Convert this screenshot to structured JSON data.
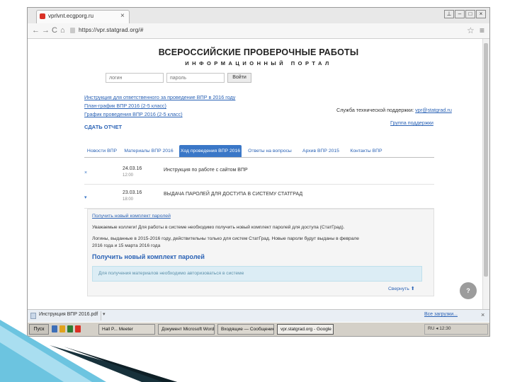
{
  "browser": {
    "tab_title": "vprlvnt.ecgporg.ru",
    "tab_close": "×",
    "address": "https://vpr.statgrad.org/#",
    "window_buttons": [
      "⊥",
      "–",
      "□",
      "×"
    ],
    "nav_glyphs": [
      "←",
      "→",
      "C",
      "⌂"
    ],
    "star_icon": "☆",
    "menu_icon": "≡"
  },
  "page": {
    "title": "ВСЕРОССИЙСКИЕ ПРОВЕРОЧНЫЕ РАБОТЫ",
    "subtitle": "ИНФОРМАЦИОННЫЙ ПОРТАЛ",
    "login_placeholder": "логин",
    "password_placeholder": "пароль",
    "login_button": "Войти",
    "links": [
      "Инструкция для ответственного за проведение ВПР в 2016 году",
      "План-график ВПР 2016 (2-5 класс)",
      "График проведения ВПР 2016 (2-5 класс)"
    ],
    "send_report": "СДАТЬ ОТЧЕТ",
    "support_label": "Служба технической поддержки:",
    "support_email": "vpr@statgrad.ru",
    "group_link": "Группа поддержки",
    "help_label": "?"
  },
  "tabs": [
    {
      "label": "Новости ВПР",
      "active": false
    },
    {
      "label": "Материалы ВПР 2016",
      "active": false
    },
    {
      "label": "Ход проведения ВПР 2016",
      "active": true
    },
    {
      "label": "Ответы на вопросы",
      "active": false
    },
    {
      "label": "Архив ВПР 2015",
      "active": false
    },
    {
      "label": "Контакты ВПР",
      "active": false
    }
  ],
  "news": [
    {
      "marker": "×",
      "date": "24.03.16",
      "time": "12:00",
      "text": "Инструкция по работе с сайтом ВПР"
    },
    {
      "marker": "▾",
      "date": "23.03.16",
      "time": "18:00",
      "text": "ВЫДАЧА ПАРОЛЕЙ ДЛЯ ДОСТУПА В СИСТЕМУ СТАТГРАД"
    }
  ],
  "detail": {
    "link": "Получить новый комплект паролей",
    "p1": "Уважаемые коллеги! Для работы в системе необходимо получить новый комплект паролей для доступа (СтатГрад).",
    "p2": "Логины, выданные в 2015-2016 году, действительны только для систем СтатГрад. Новые пароли будут выданы в феврале",
    "p3": "2016 года и 15 марта 2016 года",
    "heading": "Получить новый комплект паролей",
    "info": "Для получения материалов необходимо авторизоваться в системе",
    "up_link": "Свернуть ⬆"
  },
  "downloads": {
    "file_name": "Инструкция ВПР 2016.pdf",
    "arrow": "▾",
    "show_all": "Все загрузки...",
    "close": "×"
  },
  "taskbar": {
    "start": "Пуск",
    "buttons": [
      {
        "label": "Hall P... Meeter",
        "active": false
      },
      {
        "label": "Документ Microsoft Word",
        "active": false
      },
      {
        "label": "Входящие — Сообщение",
        "active": false
      },
      {
        "label": "vpr.statgrad.org - Google Chrome",
        "active": true
      }
    ],
    "tray": "RU  ◂  12:30"
  },
  "colors": {
    "accent": "#3a77c7",
    "link": "#2a62b5",
    "info_bg": "#dcedf5",
    "deco_dark": "#17313b",
    "deco_light": "#6cc4e0"
  }
}
